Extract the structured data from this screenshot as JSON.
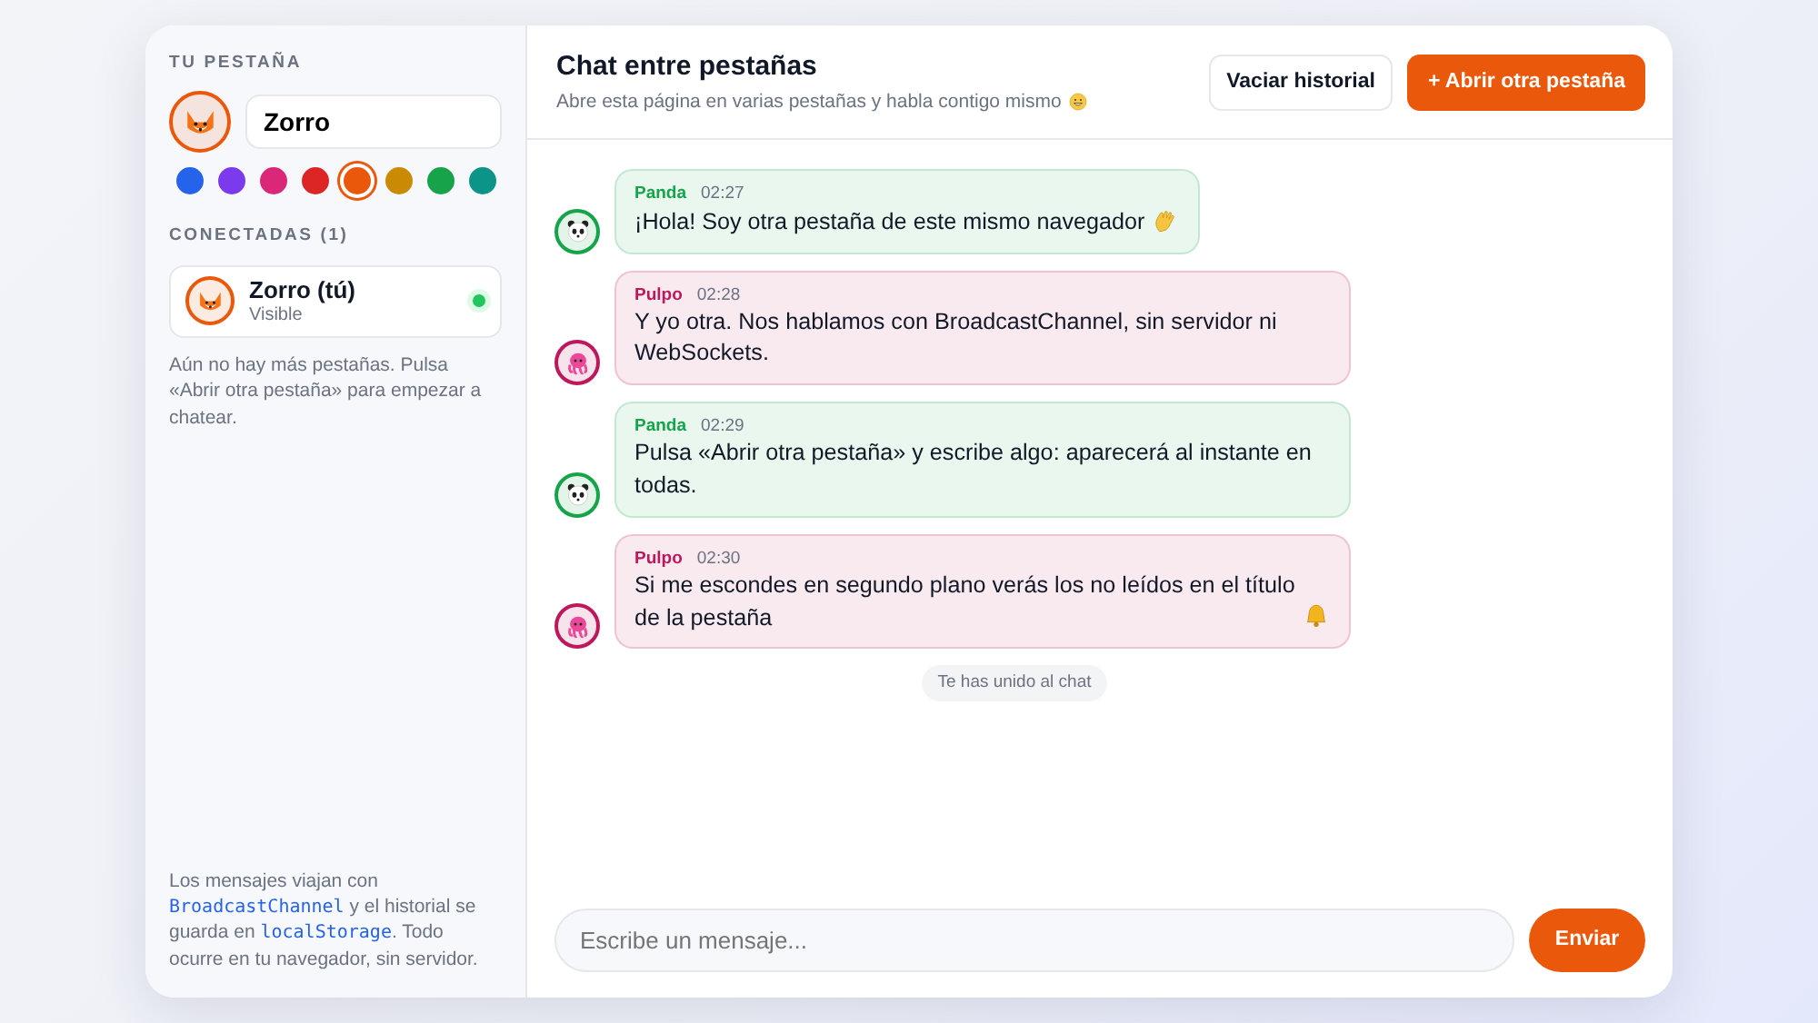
{
  "sidebar": {
    "section_title": "TU PESTAÑA",
    "avatar": {
      "kind": "fox",
      "color": "#ea580c"
    },
    "name_value": "Zorro",
    "swatches": [
      {
        "color": "#2563eb",
        "selected": false
      },
      {
        "color": "#7c3aed",
        "selected": false
      },
      {
        "color": "#db2777",
        "selected": false
      },
      {
        "color": "#dc2626",
        "selected": false
      },
      {
        "color": "#ea580c",
        "selected": true
      },
      {
        "color": "#ca8a04",
        "selected": false
      },
      {
        "color": "#16a34a",
        "selected": false
      },
      {
        "color": "#0d9488",
        "selected": false
      }
    ],
    "connected_title": "CONECTADAS (1)",
    "peers": [
      {
        "name": "Zorro (tú)",
        "status": "Visible",
        "kind": "fox",
        "color": "#ea580c",
        "online": true
      }
    ],
    "empty_hint": "Aún no hay más pestañas. Pulsa «Abrir otra pestaña» para empezar a chatear.",
    "footer_note": [
      {
        "kind": "text",
        "text": "Los mensajes viajan con "
      },
      {
        "kind": "code",
        "text": "BroadcastChannel"
      },
      {
        "kind": "text",
        "text": " y el historial se guarda en "
      },
      {
        "kind": "code",
        "text": "localStorage"
      },
      {
        "kind": "text",
        "text": ". Todo ocurre en tu navegador, sin servidor."
      }
    ]
  },
  "header": {
    "title": "Chat entre pestañas",
    "subtitle": "Abre esta página en varias pestañas y habla contigo mismo",
    "subtitle_emoji": {
      "kind": "grin"
    },
    "buttons": [
      {
        "label": "Vaciar historial",
        "kind": "secondary"
      },
      {
        "label": "+ Abrir otra pestaña",
        "kind": "primary"
      }
    ]
  },
  "messages": [
    {
      "author": "Panda",
      "time": "02:27",
      "text": "¡Hola! Soy otra pestaña de este mismo navegador",
      "emoji": {
        "kind": "wave"
      },
      "kind": "panda",
      "color": "#16a34a"
    },
    {
      "author": "Pulpo",
      "time": "02:28",
      "text": "Y yo otra. Nos hablamos con BroadcastChannel, sin servidor ni WebSockets.",
      "kind": "octopus",
      "color": "#be185d"
    },
    {
      "author": "Panda",
      "time": "02:29",
      "text": "Pulsa «Abrir otra pestaña» y escribe algo: aparecerá al instante en todas.",
      "kind": "panda",
      "color": "#16a34a"
    },
    {
      "author": "Pulpo",
      "time": "02:30",
      "text": "Si me escondes en segundo plano verás los no leídos en el título de la pestaña",
      "emoji": {
        "kind": "bell"
      },
      "kind": "octopus",
      "color": "#be185d"
    }
  ],
  "system_notice": "Te has unido al chat",
  "composer": {
    "placeholder": "Escribe un mensaje...",
    "send_label": "Enviar"
  }
}
